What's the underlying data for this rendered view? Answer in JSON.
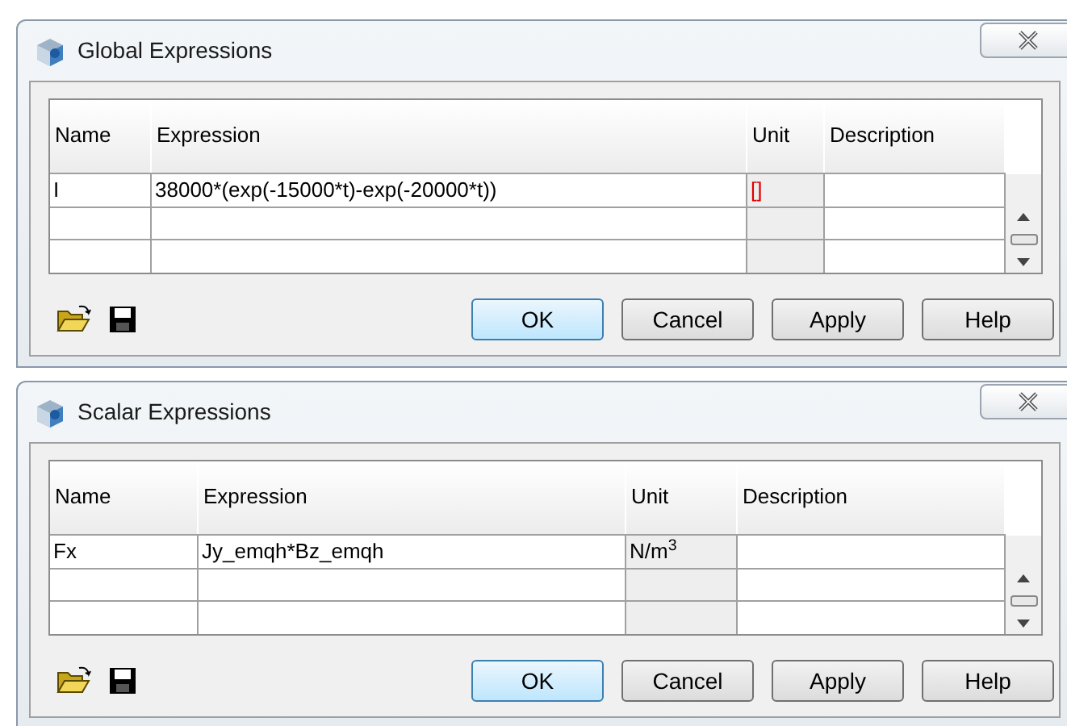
{
  "dialogs": [
    {
      "title": "Global Expressions",
      "columns": [
        "Name",
        "Expression",
        "Unit",
        "Description"
      ],
      "rows": [
        {
          "name": "I",
          "expression": "38000*(exp(-15000*t)-exp(-20000*t))",
          "unit": "[]",
          "unit_error": true
        }
      ],
      "buttons": [
        {
          "label": "OK",
          "default": true
        },
        {
          "label": "Cancel",
          "default": false
        },
        {
          "label": "Apply",
          "default": false
        },
        {
          "label": "Help",
          "default": false
        }
      ]
    },
    {
      "title": "Scalar Expressions",
      "columns": [
        "Name",
        "Expression",
        "Unit",
        "Description"
      ],
      "rows": [
        {
          "name": "Fx",
          "expression": "Jy_emqh*Bz_emqh",
          "unit": "N/m$^{3}$",
          "unit_error": false
        }
      ],
      "buttons": [
        {
          "label": "OK",
          "default": true
        },
        {
          "label": "Cancel",
          "default": false
        },
        {
          "label": "Apply",
          "default": false
        },
        {
          "label": "Help",
          "default": false
        }
      ]
    }
  ]
}
